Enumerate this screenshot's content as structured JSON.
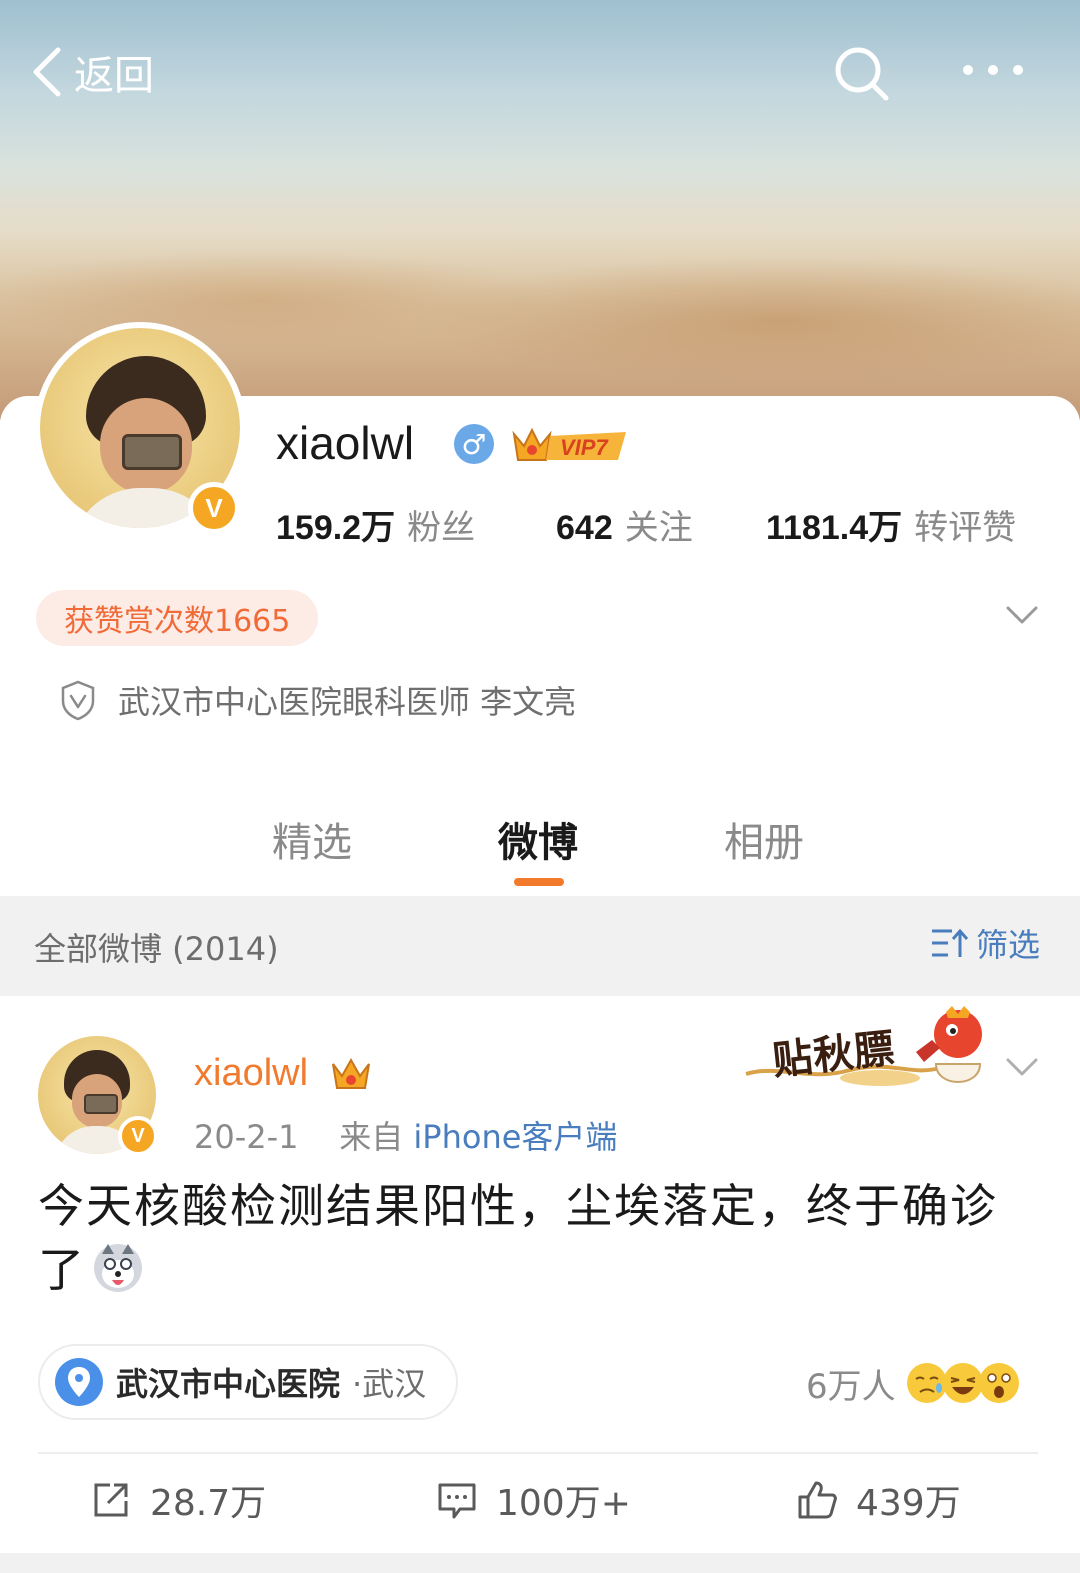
{
  "nav": {
    "back_label": "返回",
    "back_icon": "chevron-left-icon",
    "search_icon": "search-icon",
    "more_icon": "more-dots-icon"
  },
  "profile": {
    "username": "xiaolwl",
    "gender_symbol": "♂",
    "vip_label": "VIP7",
    "stats": [
      {
        "value": "159.2万",
        "label": "粉丝"
      },
      {
        "value": "642",
        "label": "关注"
      },
      {
        "value": "1181.4万",
        "label": "转评赞"
      }
    ],
    "reward_label": "获赞赏次数1665",
    "verification": "武汉市中心医院眼科医师 李文亮"
  },
  "tabs": [
    {
      "label": "精选"
    },
    {
      "label": "微博"
    },
    {
      "label": "相册"
    }
  ],
  "filter_bar": {
    "title": "全部微博 (2014)",
    "filter_label": "筛选"
  },
  "post": {
    "username": "xiaolwl",
    "date": "20-2-1",
    "from_prefix": "来自",
    "source": "iPhone客户端",
    "sticker_text": "贴秋膘",
    "text": "今天核酸检测结果阳性，尘埃落定，终于确诊了",
    "location_place": "武汉市中心医院",
    "location_city": "·武汉",
    "reactors_count": "6万人",
    "actions": {
      "repost": "28.7万",
      "comment": "100万+",
      "like": "439万"
    }
  },
  "colors": {
    "accent_orange": "#f47a2b",
    "link_blue": "#4a7dbd",
    "verified_gold": "#f5a623",
    "filter_bg": "#f1f1f1"
  }
}
